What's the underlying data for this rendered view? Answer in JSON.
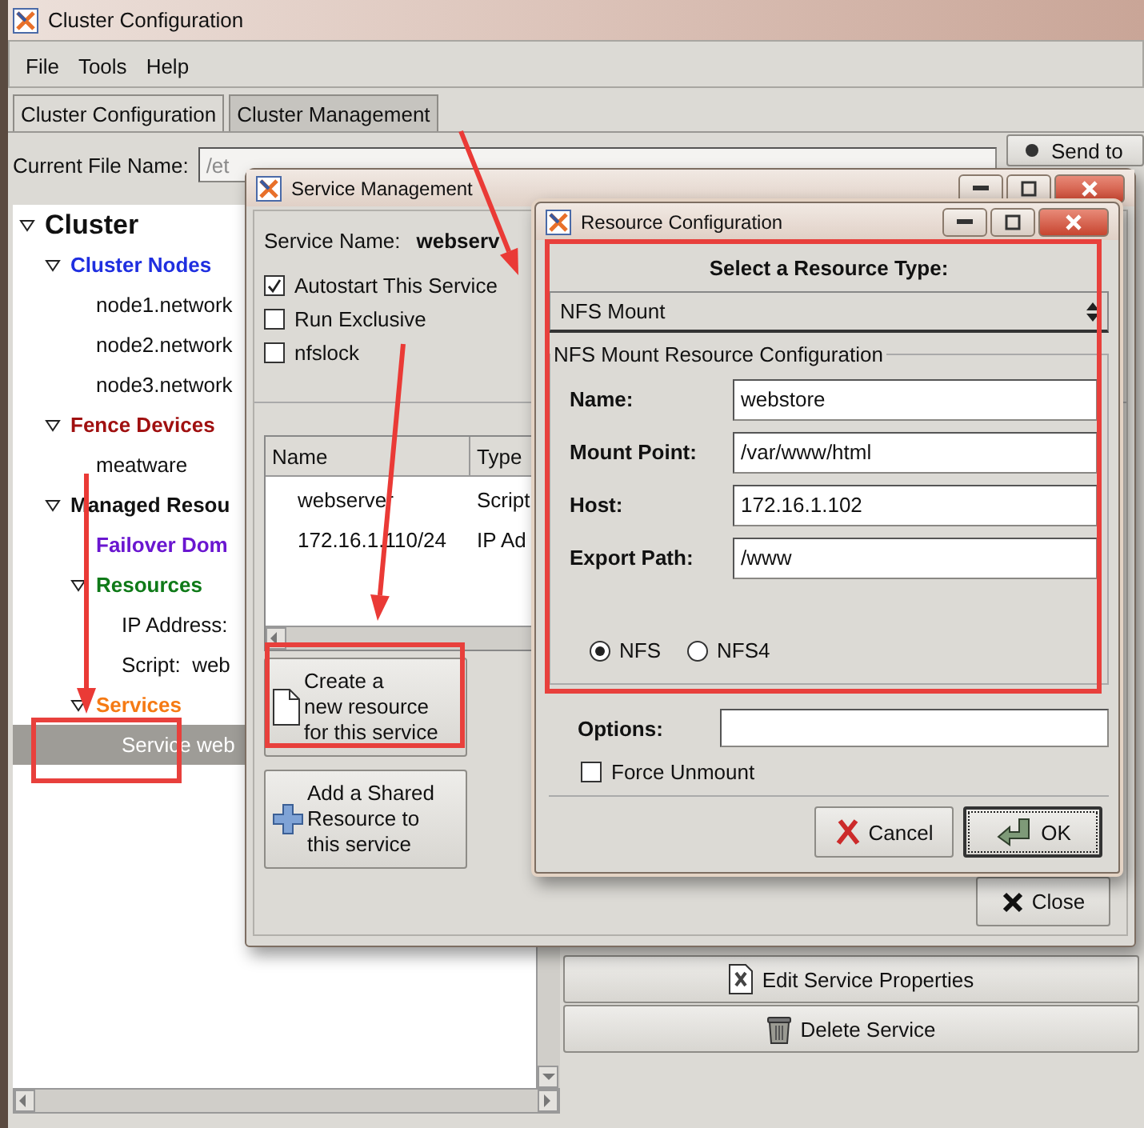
{
  "window": {
    "title": "Cluster Configuration"
  },
  "menu": [
    {
      "label": "File"
    },
    {
      "label": "Tools"
    },
    {
      "label": "Help"
    }
  ],
  "tabs": [
    {
      "label": "Cluster Configuration",
      "selected": true
    },
    {
      "label": "Cluster Management",
      "selected": false
    }
  ],
  "file_name": {
    "label": "Current File Name:",
    "value": "/et",
    "disabled": true
  },
  "send_button": {
    "label": "Send to"
  },
  "tree": [
    {
      "label": "Cluster",
      "kind": "root",
      "expanded": true,
      "selected": false,
      "children": [
        {
          "label": "Cluster Nodes",
          "kind": "category",
          "color": "#1f2fe0",
          "expanded": true,
          "selected": false,
          "children": [
            {
              "label": "node1.network",
              "kind": "item",
              "selected": false
            },
            {
              "label": "node2.network",
              "kind": "item",
              "selected": false
            },
            {
              "label": "node3.network",
              "kind": "item",
              "selected": false
            }
          ]
        },
        {
          "label": "Fence Devices",
          "kind": "category",
          "color": "#a01010",
          "expanded": true,
          "selected": false,
          "children": [
            {
              "label": "meatware",
              "kind": "item",
              "selected": false
            }
          ]
        },
        {
          "label": "Managed Resou",
          "kind": "category",
          "color": "#111111",
          "expanded": true,
          "selected": false,
          "children": [
            {
              "label": "Failover Dom",
              "kind": "category",
              "color": "#6a16d0",
              "selected": false
            },
            {
              "label": "Resources",
              "kind": "category",
              "color": "#0f7a18",
              "expanded": true,
              "selected": false,
              "children": [
                {
                  "label": "IP Address:",
                  "kind": "item",
                  "selected": false
                },
                {
                  "label": "Script:  web",
                  "kind": "item",
                  "selected": false
                }
              ]
            },
            {
              "label": "Services",
              "kind": "category",
              "color": "#f57a14",
              "expanded": true,
              "selected": false,
              "children": [
                {
                  "label": "Service web",
                  "kind": "item",
                  "selected": true
                }
              ]
            }
          ]
        }
      ]
    }
  ],
  "actions": [
    {
      "label": "Edit Service Properties",
      "kind": "edit"
    },
    {
      "label": "Delete Service",
      "kind": "delete"
    }
  ],
  "service_dialog": {
    "title": "Service Management",
    "name_label": "Service Name:",
    "name_value": "webserv",
    "options": [
      {
        "label": "Autostart This Service",
        "checked": true
      },
      {
        "label": "Run Exclusive",
        "checked": false
      },
      {
        "label": "nfslock",
        "checked": false
      }
    ],
    "table": {
      "columns": [
        "Name",
        "Type"
      ],
      "rows": [
        [
          "webserver",
          "Script"
        ],
        [
          "172.16.1.110/24",
          "IP Ad"
        ]
      ]
    },
    "buttons": [
      {
        "kind": "new",
        "lines": [
          "Create a",
          "new resource",
          "for this service"
        ]
      },
      {
        "kind": "shared",
        "lines": [
          "Add a Shared",
          "Resource to",
          "this service"
        ]
      }
    ],
    "close_button": {
      "label": "Close"
    }
  },
  "resource_dialog": {
    "title": "Resource Configuration",
    "heading": "Select a Resource Type:",
    "resource_type": "NFS Mount",
    "group_title": "NFS Mount Resource Configuration",
    "fields": [
      {
        "label": "Name:",
        "value": "webstore"
      },
      {
        "label": "Mount Point:",
        "value": "/var/www/html"
      },
      {
        "label": "Host:",
        "value": "172.16.1.102"
      },
      {
        "label": "Export Path:",
        "value": "/www"
      }
    ],
    "protocols": [
      {
        "label": "NFS",
        "selected": true
      },
      {
        "label": "NFS4",
        "selected": false
      }
    ],
    "options": {
      "label": "Options:"
    },
    "force_unmount": {
      "label": "Force Unmount",
      "checked": false
    },
    "buttons": [
      {
        "kind": "cancel",
        "label": "Cancel",
        "focused": false
      },
      {
        "kind": "ok",
        "label": "OK",
        "focused": true
      }
    ]
  }
}
